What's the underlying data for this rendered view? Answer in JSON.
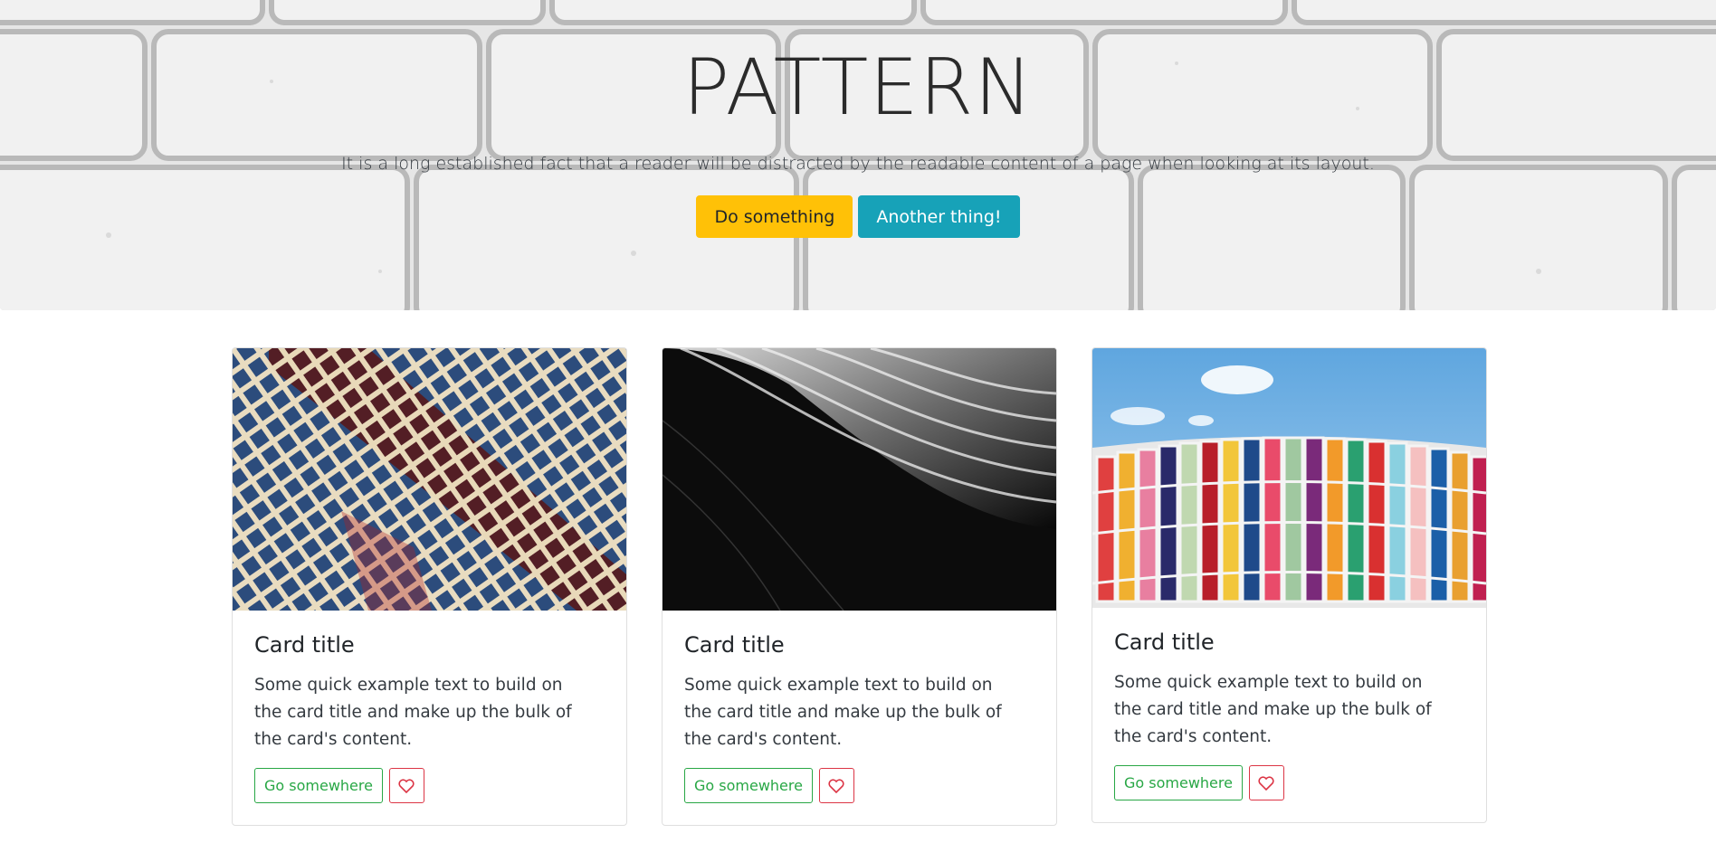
{
  "hero": {
    "title": "PATTERN",
    "lead": "It is a long established fact that a reader will be distracted by the readable content of a page when looking at its layout.",
    "primary_button": "Do something",
    "secondary_button": "Another thing!"
  },
  "cards": [
    {
      "image": "blue building facade",
      "title": "Card title",
      "text": "Some quick example text to build on the card title and make up the bulk of the card's content.",
      "button": "Go somewhere",
      "like_icon": "heart-icon"
    },
    {
      "image": "monochrome curved architecture",
      "title": "Card title",
      "text": "Some quick example text to build on the card title and make up the bulk of the card's content.",
      "button": "Go somewhere",
      "like_icon": "heart-icon"
    },
    {
      "image": "colorful glass panels",
      "title": "Card title",
      "text": "Some quick example text to build on the card title and make up the bulk of the card's content.",
      "button": "Go somewhere",
      "like_icon": "heart-icon"
    }
  ],
  "colors": {
    "warning": "#ffc107",
    "info": "#17a2b8",
    "success": "#28a745",
    "danger": "#dc3545"
  }
}
